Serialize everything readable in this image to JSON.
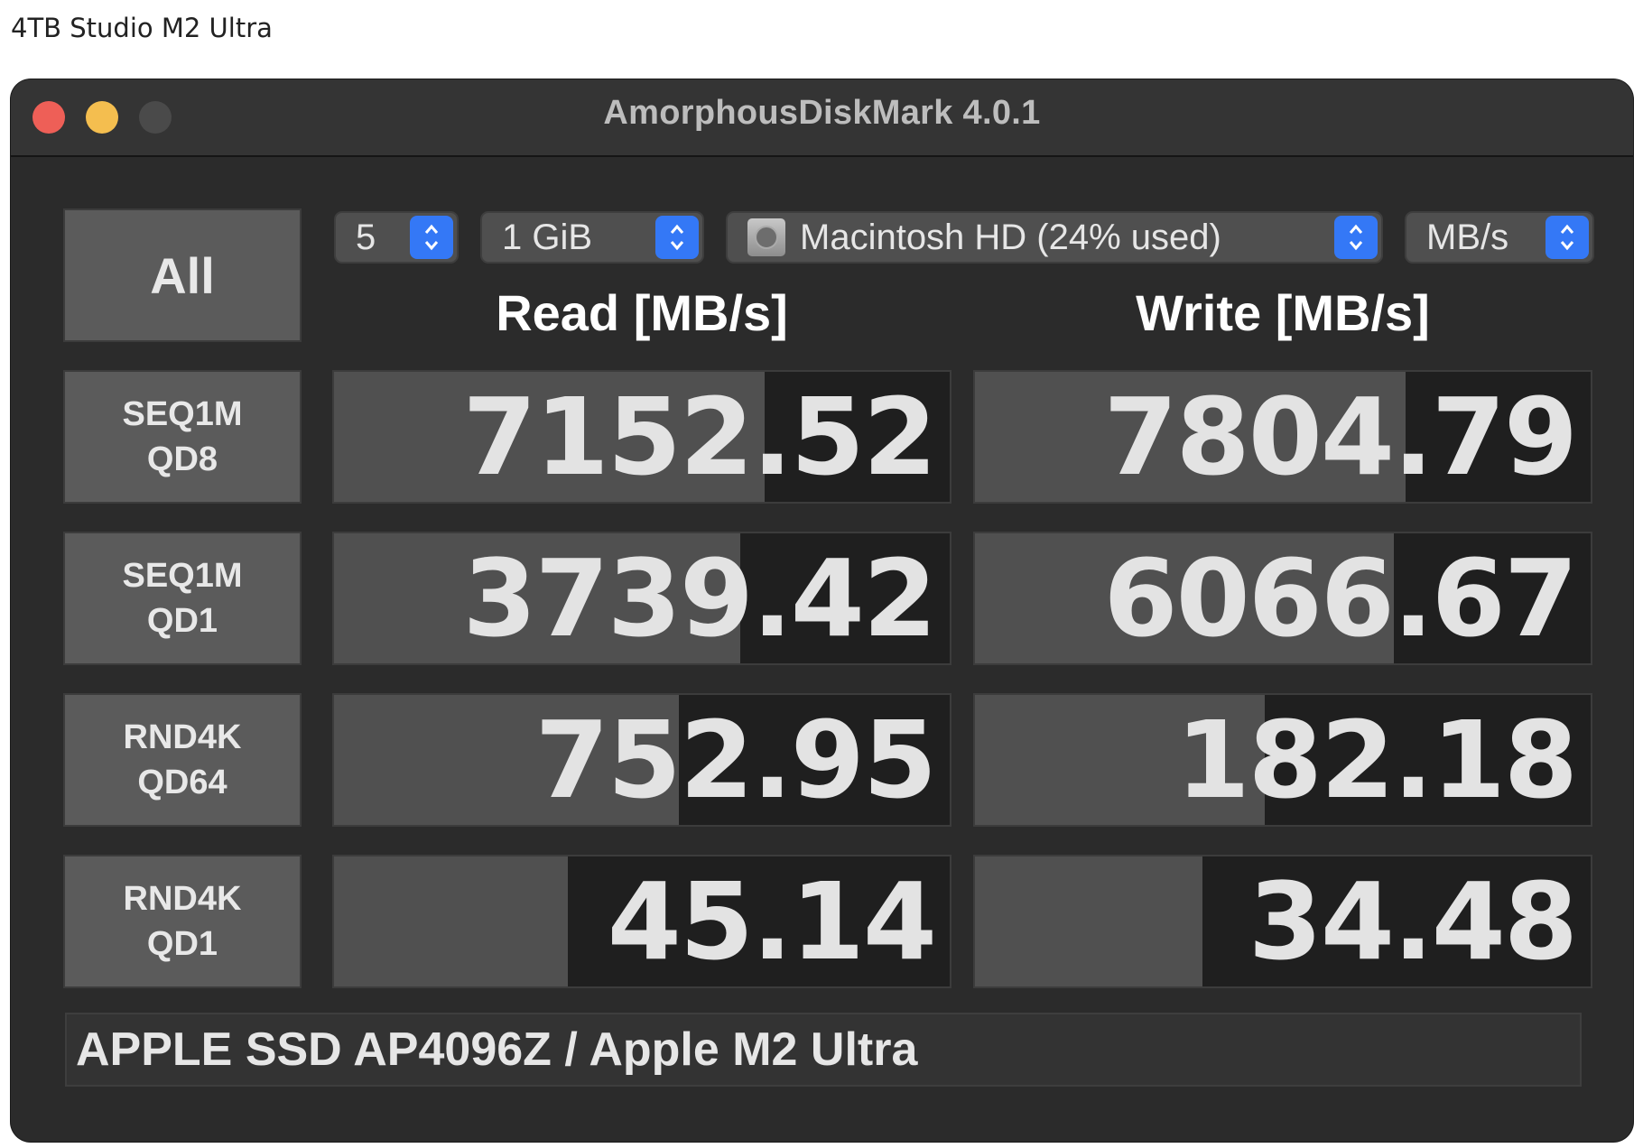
{
  "caption": "4TB Studio M2 Ultra",
  "window": {
    "title": "AmorphousDiskMark 4.0.1"
  },
  "controls": {
    "all_label": "All",
    "count": "5",
    "size": "1 GiB",
    "disk": "Macintosh HD (24% used)",
    "unit": "MB/s"
  },
  "headers": {
    "read": "Read [MB/s]",
    "write": "Write [MB/s]"
  },
  "rows": [
    {
      "line1": "SEQ1M",
      "line2": "QD8",
      "read": "7152.52",
      "read_fill": 0.7,
      "write": "7804.79",
      "write_fill": 0.7
    },
    {
      "line1": "SEQ1M",
      "line2": "QD1",
      "read": "3739.42",
      "read_fill": 0.66,
      "write": "6066.67",
      "write_fill": 0.68
    },
    {
      "line1": "RND4K",
      "line2": "QD64",
      "read": "752.95",
      "read_fill": 0.56,
      "write": "182.18",
      "write_fill": 0.47
    },
    {
      "line1": "RND4K",
      "line2": "QD1",
      "read": "45.14",
      "read_fill": 0.38,
      "write": "34.48",
      "write_fill": 0.37
    }
  ],
  "device_info": "APPLE SSD AP4096Z / Apple M2 Ultra",
  "colors": {
    "window_bg": "#2b2b2b",
    "button_bg": "#5b5b5b",
    "bar_fill": "#505050",
    "cell_bg": "#1f1f1f",
    "accent": "#3478f6",
    "close": "#ee5f57",
    "minimize": "#f4be4f"
  }
}
